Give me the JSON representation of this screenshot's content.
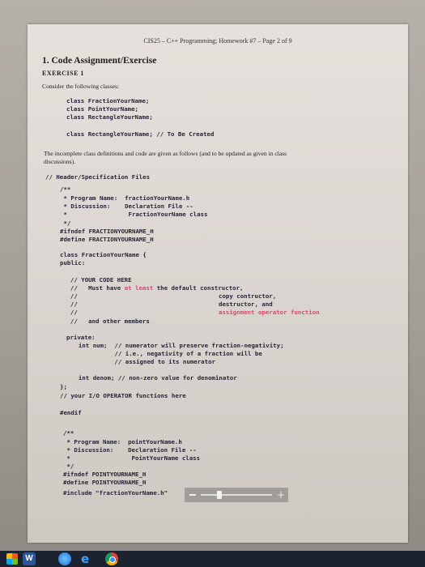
{
  "document": {
    "header": "CIS25 – C++ Programming; Homework #7 – Page 2 of 9",
    "title": "1. Code Assignment/Exercise",
    "exercise": "EXERCISE 1",
    "intro": "Consider the following classes:",
    "classes": [
      "class FractionYourName;",
      "class PointYourName;",
      "class RectangleYourName;"
    ],
    "class_rect_note": "class RectangleYourName; // To Be Created",
    "desc_line1": "The incomplete class definitions and code are given as follows (and to be updated as given in class",
    "desc_line2": "discussions).",
    "code_lines": [
      "// Header/Specification Files",
      "/**",
      " * Program Name:  fractionYourName.h",
      " * Discussion:    Declaration File --",
      " *                 FractionYourName class",
      " */",
      "#ifndef FRACTIONYOURNAME_H",
      "#define FRACTIONYOURNAME_H",
      "class FractionYourName {",
      "public:",
      "  // YOUR CODE HERE",
      "  //   Must have ",
      "  //",
      "  //",
      "  //",
      "  //   and other members",
      "private:",
      "  int num;  // numerator will preserve fraction-negativity;",
      "            // i.e., negativity of a fraction will be",
      "            // assigned to its numerator",
      "  int denom; // non-zero value for denominator",
      "};",
      "// your I/O OPERATOR functions here",
      "#endif",
      "/**",
      " * Program Name:  pointYourName.h",
      " * Discussion:    Declaration File --",
      " *                 PointYourName class",
      " */",
      "#ifndef POINTYOURNAME_H",
      "#define POINTYOURNAME_H",
      "#include \"fractionYourName.h\""
    ],
    "highlight_at_least": "at least",
    "highlight_after": " the default constructor,",
    "copy_ctor": "copy contructor,",
    "dtor": "destructor, and",
    "assign_op": "assignment operator function"
  },
  "taskbar": {
    "word_label": "W"
  },
  "colors": {
    "accent_pink": "#d84b6e",
    "taskbar": "#1b2330"
  }
}
